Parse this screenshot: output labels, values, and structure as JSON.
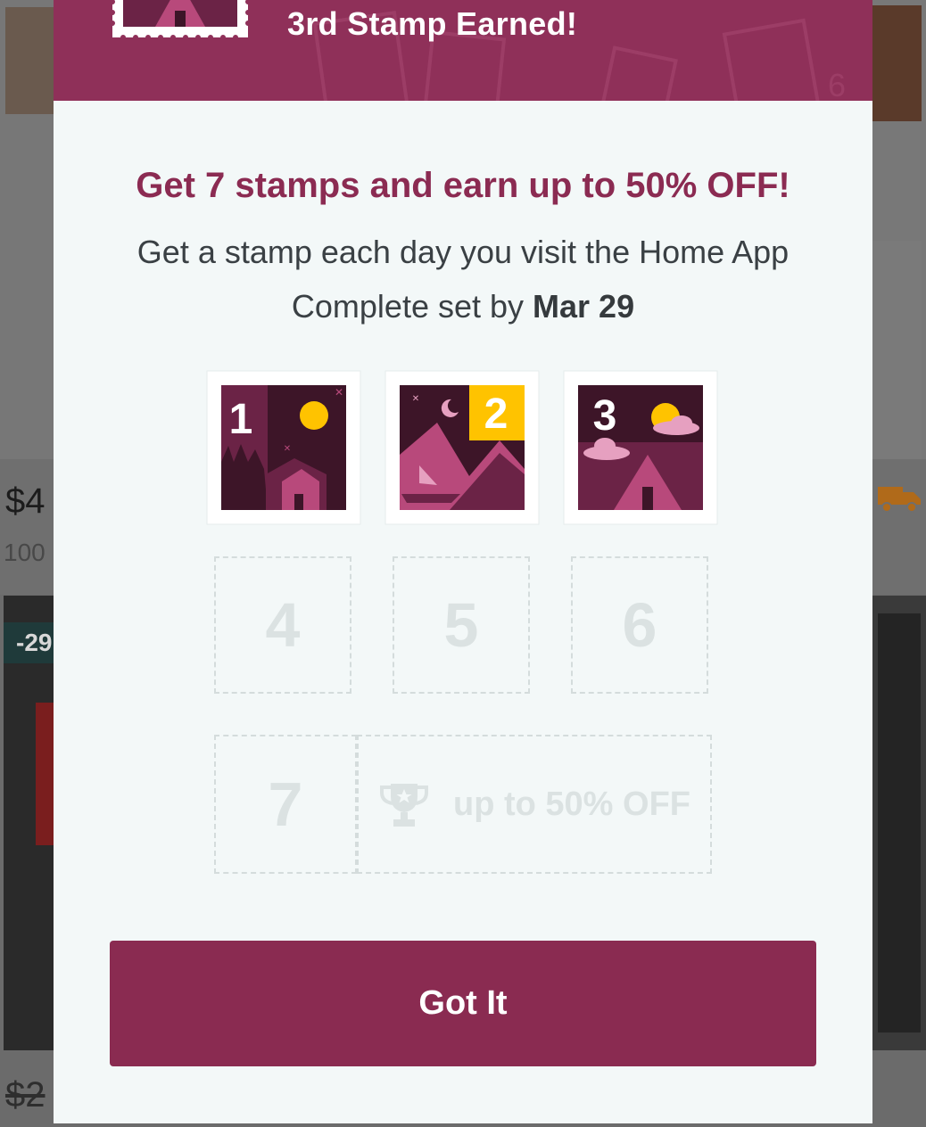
{
  "background": {
    "price": "$4",
    "sold_count": "100",
    "old_price": "$2",
    "discount_badge": "-29",
    "icons": [
      "truck-icon"
    ]
  },
  "modal": {
    "header_title": "3rd Stamp Earned!",
    "headline": "Get 7 stamps and earn up to 50% OFF!",
    "subline": "Get a stamp each day you visit the Home App",
    "deadline_prefix": "Complete set by",
    "deadline_date": "Mar 29",
    "earned_stamps": [
      {
        "number": "1",
        "scene": "sun-night-house"
      },
      {
        "number": "2",
        "scene": "moon-mountains-boat"
      },
      {
        "number": "3",
        "scene": "sun-clouds-tent"
      }
    ],
    "empty_stamps": [
      "4",
      "5",
      "6",
      "7"
    ],
    "reward_label": "up to 50% OFF",
    "reward_icon": "trophy-icon",
    "button_label": "Got It"
  },
  "colors": {
    "brand": "#8a2b51",
    "header": "#8f3059",
    "modal_bg": "#f3f8f8",
    "stamp_yellow": "#ffc300",
    "stamp_dark": "#3d1528",
    "empty_gray": "#dbe2e2"
  }
}
